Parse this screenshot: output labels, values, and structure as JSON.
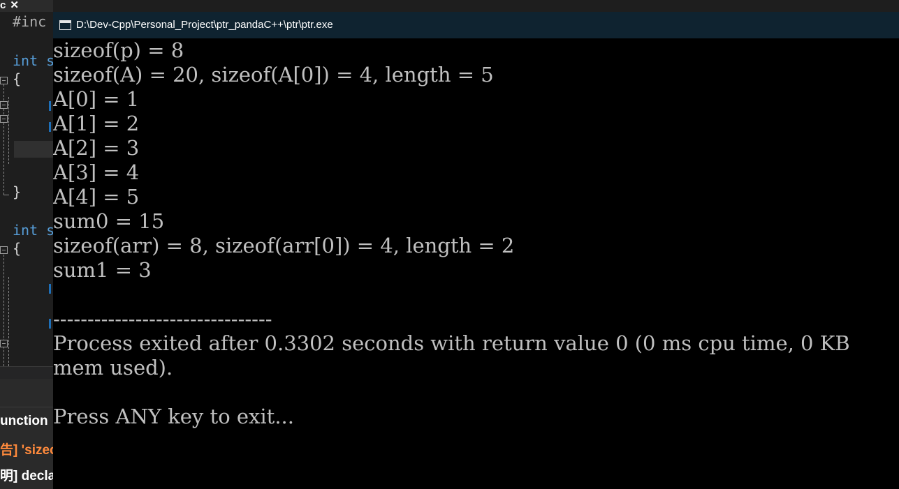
{
  "ide": {
    "tab": {
      "label": "c",
      "close_glyph": "✕"
    },
    "code_lines": [
      {
        "kind": "pp",
        "text": "#inc"
      },
      {
        "kind": "kw",
        "text": "int s"
      },
      {
        "kind": "br",
        "text": "{"
      },
      {
        "kind": "br",
        "text": "}"
      },
      {
        "kind": "kw",
        "text": "int s"
      },
      {
        "kind": "br",
        "text": "{"
      }
    ],
    "bottom_panel": {
      "header": "unction",
      "messages": [
        {
          "text": "告] 'sizeo",
          "color": "#ff8a3c"
        },
        {
          "text": "明] declar",
          "color": "#ffffff"
        }
      ]
    }
  },
  "console": {
    "title": "D:\\Dev-Cpp\\Personal_Project\\ptr_pandaC++\\ptr\\ptr.exe",
    "output_lines": [
      "sizeof(p) = 8",
      "sizeof(A) = 20, sizeof(A[0]) = 4, length = 5",
      "A[0] = 1",
      "A[1] = 2",
      "A[2] = 3",
      "A[3] = 4",
      "A[4] = 5",
      "sum0 = 15",
      "sizeof(arr) = 8, sizeof(arr[0]) = 4, length = 2",
      "sum1 = 3",
      "",
      "--------------------------------",
      "Process exited after 0.3302 seconds with return value 0 (0 ms cpu time, 0 KB",
      "mem used).",
      "",
      "Press ANY key to exit..."
    ]
  }
}
